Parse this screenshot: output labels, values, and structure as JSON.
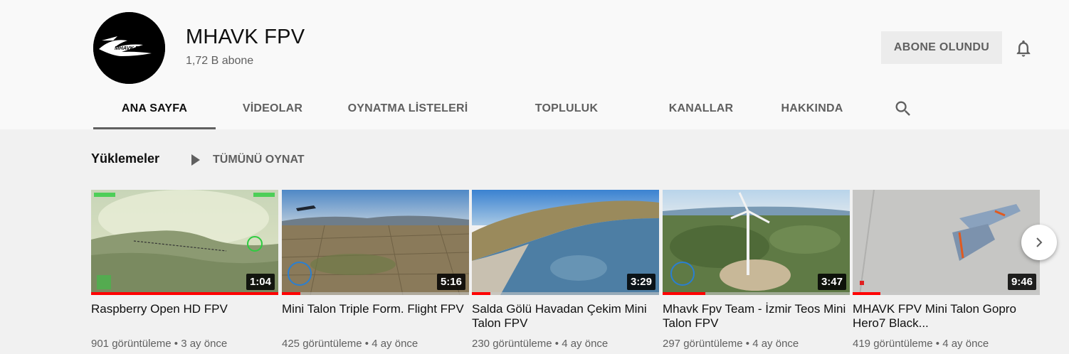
{
  "channel": {
    "name": "MHAVK FPV",
    "subscribers": "1,72 B abone",
    "logo_text": "MHAVK FPV TEAM",
    "subscribe_label": "ABONE OLUNDU"
  },
  "tabs": [
    {
      "label": "ANA SAYFA",
      "active": true
    },
    {
      "label": "VİDEOLAR"
    },
    {
      "label": "OYNATMA LİSTELERİ"
    },
    {
      "label": "TOPLULUK"
    },
    {
      "label": "KANALLAR"
    },
    {
      "label": "HAKKINDA"
    }
  ],
  "section": {
    "title": "Yüklemeler",
    "play_all": "TÜMÜNÜ OYNAT"
  },
  "videos": [
    {
      "title": "Raspberry Open HD FPV",
      "views": "901 görüntüleme",
      "age": "3 ay önce",
      "duration": "1:04",
      "watched": 1.0
    },
    {
      "title": "Mini Talon Triple Form. Flight FPV",
      "views": "425 görüntüleme",
      "age": "4 ay önce",
      "duration": "5:16",
      "watched": 0.1
    },
    {
      "title": "Salda Gölü Havadan Çekim Mini Talon FPV",
      "views": "230 görüntüleme",
      "age": "4 ay önce",
      "duration": "3:29",
      "watched": 0.1
    },
    {
      "title": "Mhavk Fpv Team - İzmir Teos Mini Talon FPV",
      "views": "297 görüntüleme",
      "age": "4 ay önce",
      "duration": "3:47",
      "watched": 0.23
    },
    {
      "title": "MHAVK FPV Mini Talon Gopro Hero7 Black...",
      "views": "419 görüntüleme",
      "age": "4 ay önce",
      "duration": "9:46",
      "watched": 0.15
    }
  ],
  "meta_separator": "•",
  "colors": {
    "accent": "#ff0000",
    "secondary_text": "#606060"
  }
}
